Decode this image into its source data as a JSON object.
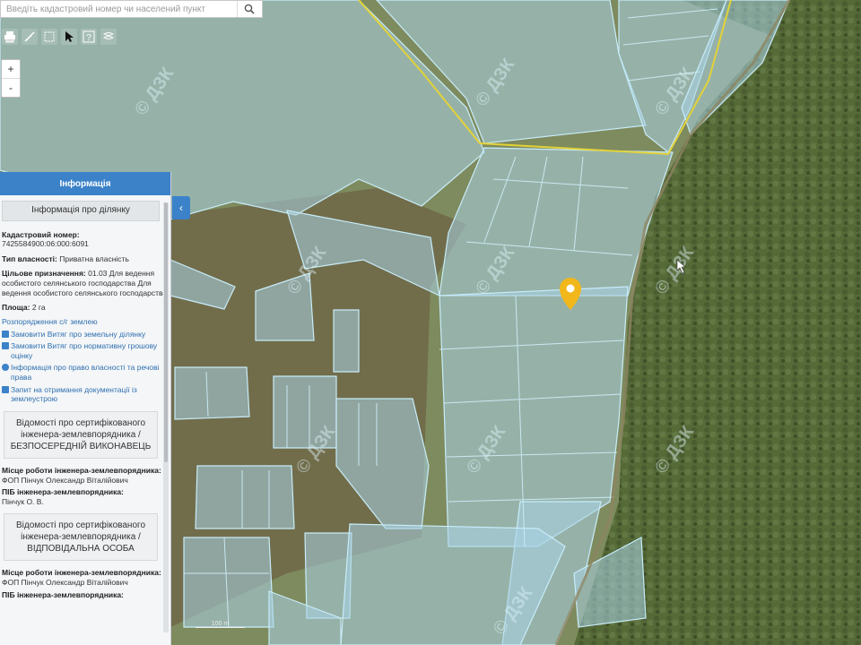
{
  "search": {
    "placeholder": "Введіть кадастровий номер чи населений пункт"
  },
  "zoom": {
    "in_label": "+",
    "out_label": "-"
  },
  "panel": {
    "title": "Інформація",
    "section_title": "Інформація про ділянку",
    "cadastral_label": "Кадастровий номер:",
    "cadastral_value": "7425584900:06:000:6091",
    "ownership_label": "Тип власності:",
    "ownership_value": "Приватна власність",
    "purpose_label": "Цільове призначення:",
    "purpose_value": "01.03 Для ведення особистого селянського господарства Для ведення особистого селянського господарства",
    "area_label": "Площа:",
    "area_value": "2 га",
    "disposal_link": "Розпорядження с/г землею",
    "links": [
      "Замовити Витяг про земельну ділянку",
      "Замовити Витяг про нормативну грошову оцінку",
      "Інформація про право власності та речові права",
      "Запит на отримання документації із землеустрою"
    ],
    "cert1": "Відомості про сертифікованого інженера-землевпорядника / БЕЗПОСЕРЕДНІЙ ВИКОНАВЕЦЬ",
    "work_label": "Місце роботи інженера-землевпорядника:",
    "work_value": "ФОП Пінчук Олександр Віталійович",
    "name_label": "ПІБ інженера-землевпорядника:",
    "name_value": "Пінчук О. В.",
    "cert2": "Відомості про сертифікованого інженера-землевпорядника / ВІДПОВІДАЛЬНА ОСОБА",
    "work2_label": "Місце роботи інженера-землевпорядника:",
    "work2_value": "ФОП Пінчук Олександр Віталійович",
    "name2_label": "ПІБ інженера-землевпорядника:"
  },
  "scale_label": "100 m",
  "colors": {
    "accent": "#3b82c9",
    "parcel_fill": "#a9d3e6",
    "parcel_stroke": "#bfe6f5",
    "boundary": "#e2d23a",
    "marker": "#f2b71b"
  }
}
